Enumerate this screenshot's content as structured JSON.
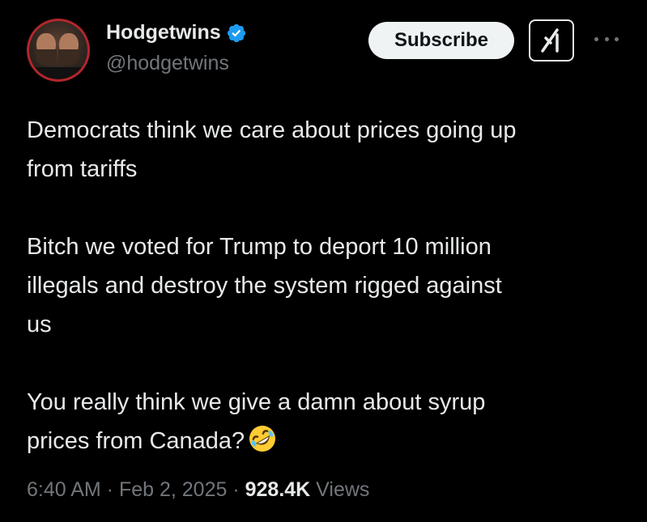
{
  "author": {
    "display_name": "Hodgetwins",
    "handle": "@hodgetwins",
    "verified": true
  },
  "actions": {
    "subscribe_label": "Subscribe",
    "grok_icon": "grok-icon",
    "more_icon": "more-horizontal-icon"
  },
  "tweet": {
    "lines": [
      "Democrats think we care about prices going up",
      "from tariffs",
      "Bitch we voted for Trump to deport 10 million",
      "illegals and destroy the system rigged against",
      "us",
      "You really think we give a damn about syrup",
      "prices from Canada?"
    ],
    "emoji": "rolling-on-floor-laughing"
  },
  "meta": {
    "time": "6:40 AM",
    "sep1": " · ",
    "date": "Feb 2, 2025",
    "sep2": " · ",
    "views_count": "928.4K",
    "views_label": " Views"
  },
  "colors": {
    "background": "#000000",
    "text": "#e7e9ea",
    "secondary": "#71767b",
    "verified": "#1d9bf0"
  }
}
